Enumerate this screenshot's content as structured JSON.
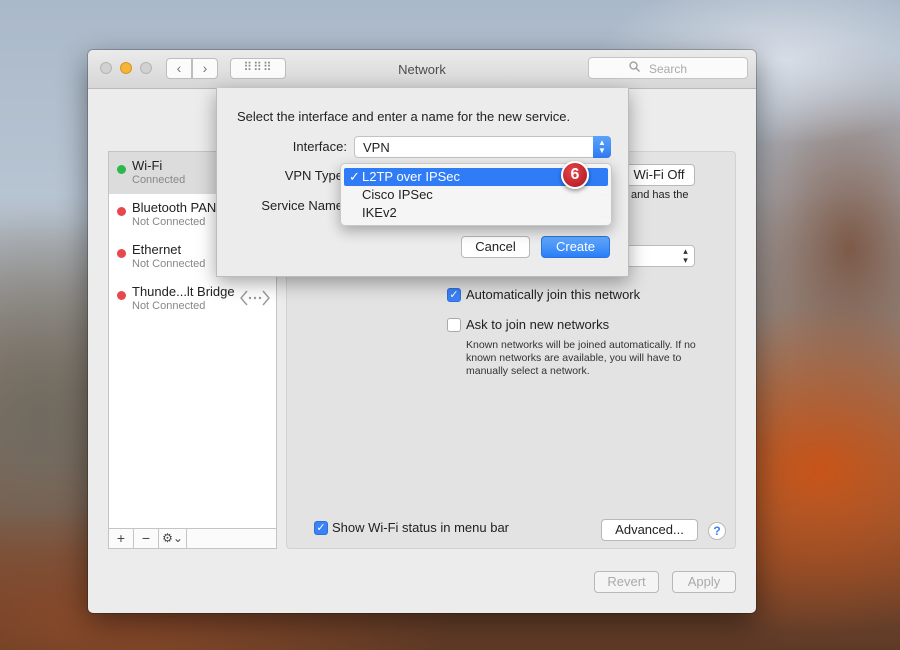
{
  "window": {
    "title": "Network",
    "search_placeholder": "Search",
    "grid_label": "⠿⠿⠿"
  },
  "sidebar": {
    "items": [
      {
        "name": "Wi-Fi",
        "status": "Connected",
        "dot_color": "#2db84b"
      },
      {
        "name": "Bluetooth PAN",
        "status": "Not Connected",
        "dot_color": "#e5484d"
      },
      {
        "name": "Ethernet",
        "status": "Not Connected",
        "dot_color": "#e5484d"
      },
      {
        "name": "Thunde...lt Bridge",
        "status": "Not Connected",
        "dot_color": "#e5484d"
      }
    ],
    "tools": {
      "add": "+",
      "remove": "−",
      "gear": "⚙⌄"
    }
  },
  "panel": {
    "turn_off_label": "Wi-Fi Off",
    "partial_text": "and has the",
    "auto_join_label": "Automatically join this network",
    "ask_join_label": "Ask to join new networks",
    "ask_join_note": "Known networks will be joined automatically. If no known networks are available, you will have to manually select a network.",
    "show_status_label": "Show Wi-Fi status in menu bar",
    "advanced_label": "Advanced...",
    "help_label": "?",
    "revert_label": "Revert",
    "apply_label": "Apply"
  },
  "sheet": {
    "prompt": "Select the interface and enter a name for the new service.",
    "interface_label": "Interface:",
    "interface_value": "VPN",
    "vpn_type_label": "VPN Type",
    "service_name_label": "Service Name",
    "cancel_label": "Cancel",
    "create_label": "Create"
  },
  "vpn_menu": {
    "options": [
      "L2TP over IPSec",
      "Cisco IPSec",
      "IKEv2"
    ],
    "selected": "L2TP over IPSec",
    "check": "✓"
  },
  "step_badge": "6",
  "colors": {
    "accent": "#2f7cf6",
    "connected": "#2db84b",
    "disconnected": "#e5484d",
    "badge": "#c8262b"
  }
}
